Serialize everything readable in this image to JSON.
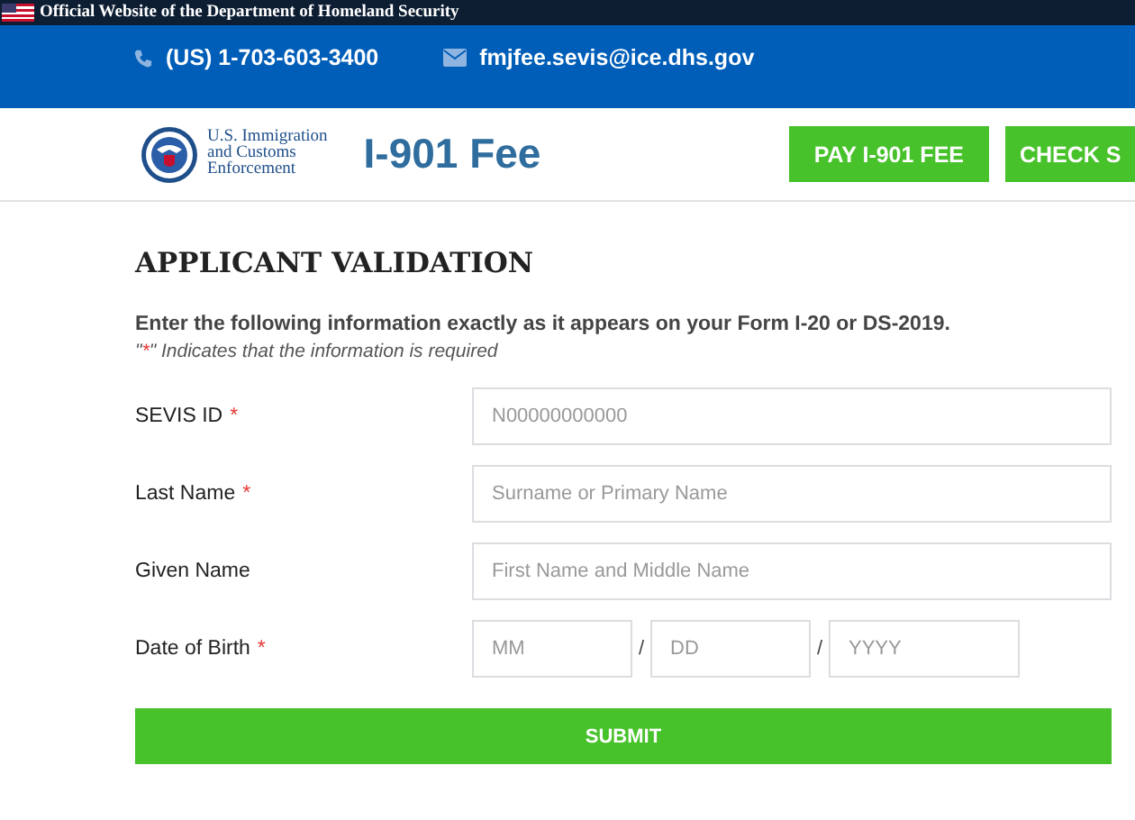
{
  "gov_banner": {
    "text": "Official Website of the Department of Homeland Security"
  },
  "contact_bar": {
    "phone": "(US) 1-703-603-3400",
    "email": "fmjfee.sevis@ice.dhs.gov"
  },
  "header": {
    "agency_lines": [
      "U.S. Immigration",
      "and Customs",
      "Enforcement"
    ],
    "site_title": "I-901 Fee",
    "nav_buttons": [
      {
        "label": "PAY I-901 FEE"
      },
      {
        "label": "CHECK S"
      }
    ]
  },
  "form": {
    "title": "APPLICANT VALIDATION",
    "instruction": "Enter the following information exactly as it appears on your Form I-20 or DS-2019.",
    "note": {
      "before": "\"",
      "mark": "*",
      "after": "\" Indicates that the information is required"
    },
    "fields": [
      {
        "kind": "text",
        "label": "SEVIS ID",
        "required_mark": "*",
        "placeholder": "N00000000000"
      },
      {
        "kind": "text",
        "label": "Last Name",
        "required_mark": "*",
        "placeholder": "Surname or Primary Name"
      },
      {
        "kind": "text",
        "label": "Given Name",
        "placeholder": "First Name and Middle Name"
      },
      {
        "kind": "date",
        "label": "Date of Birth",
        "required_mark": "*",
        "parts": [
          {
            "placeholder": "MM"
          },
          {
            "separator": "/",
            "placeholder": "DD"
          },
          {
            "separator": "/",
            "placeholder": "YYYY"
          }
        ]
      }
    ],
    "submit": "SUBMIT"
  }
}
